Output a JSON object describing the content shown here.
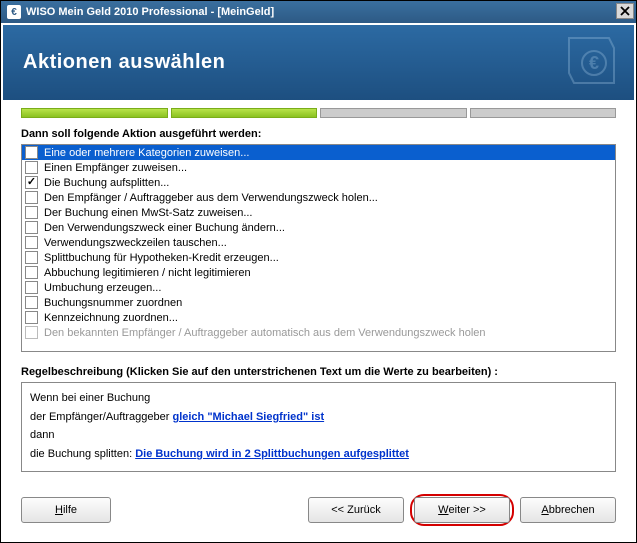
{
  "window": {
    "title": "WISO Mein Geld 2010 Professional - [MeinGeld]"
  },
  "header": {
    "title": "Aktionen auswählen"
  },
  "section": {
    "action_label": "Dann soll folgende Aktion ausgeführt werden:",
    "rule_label": "Regelbeschreibung (Klicken Sie auf den unterstrichenen Text um die Werte zu bearbeiten) :"
  },
  "actions": [
    {
      "label": "Eine oder mehrere Kategorien zuweisen...",
      "checked": false,
      "selected": true,
      "disabled": false
    },
    {
      "label": "Einen Empfänger zuweisen...",
      "checked": false,
      "selected": false,
      "disabled": false
    },
    {
      "label": "Die Buchung aufsplitten...",
      "checked": true,
      "selected": false,
      "disabled": false
    },
    {
      "label": "Den Empfänger / Auftraggeber aus dem Verwendungszweck holen...",
      "checked": false,
      "selected": false,
      "disabled": false
    },
    {
      "label": "Der Buchung einen MwSt-Satz zuweisen...",
      "checked": false,
      "selected": false,
      "disabled": false
    },
    {
      "label": "Den Verwendungszweck einer Buchung ändern...",
      "checked": false,
      "selected": false,
      "disabled": false
    },
    {
      "label": "Verwendungszweckzeilen tauschen...",
      "checked": false,
      "selected": false,
      "disabled": false
    },
    {
      "label": "Splittbuchung für Hypotheken-Kredit erzeugen...",
      "checked": false,
      "selected": false,
      "disabled": false
    },
    {
      "label": "Abbuchung legitimieren / nicht legitimieren",
      "checked": false,
      "selected": false,
      "disabled": false
    },
    {
      "label": "Umbuchung erzeugen...",
      "checked": false,
      "selected": false,
      "disabled": false
    },
    {
      "label": "Buchungsnummer zuordnen",
      "checked": false,
      "selected": false,
      "disabled": false
    },
    {
      "label": "Kennzeichnung zuordnen...",
      "checked": false,
      "selected": false,
      "disabled": false
    },
    {
      "label": "Den bekannten Empfänger / Auftraggeber automatisch aus dem Verwendungszweck holen",
      "checked": false,
      "selected": false,
      "disabled": true
    }
  ],
  "rule": {
    "line1_prefix": "Wenn bei einer Buchung",
    "line2_prefix": "der Empfänger/Auftraggeber ",
    "line2_link": "gleich \"Michael Siegfried\" ist",
    "line3": "dann",
    "line4_prefix": "die Buchung splitten: ",
    "line4_link": "Die Buchung wird in 2 Splittbuchungen aufgesplittet"
  },
  "buttons": {
    "help": "Hilfe",
    "back": "<< Zurück",
    "next": "Weiter >>",
    "cancel": "Abbrechen"
  }
}
